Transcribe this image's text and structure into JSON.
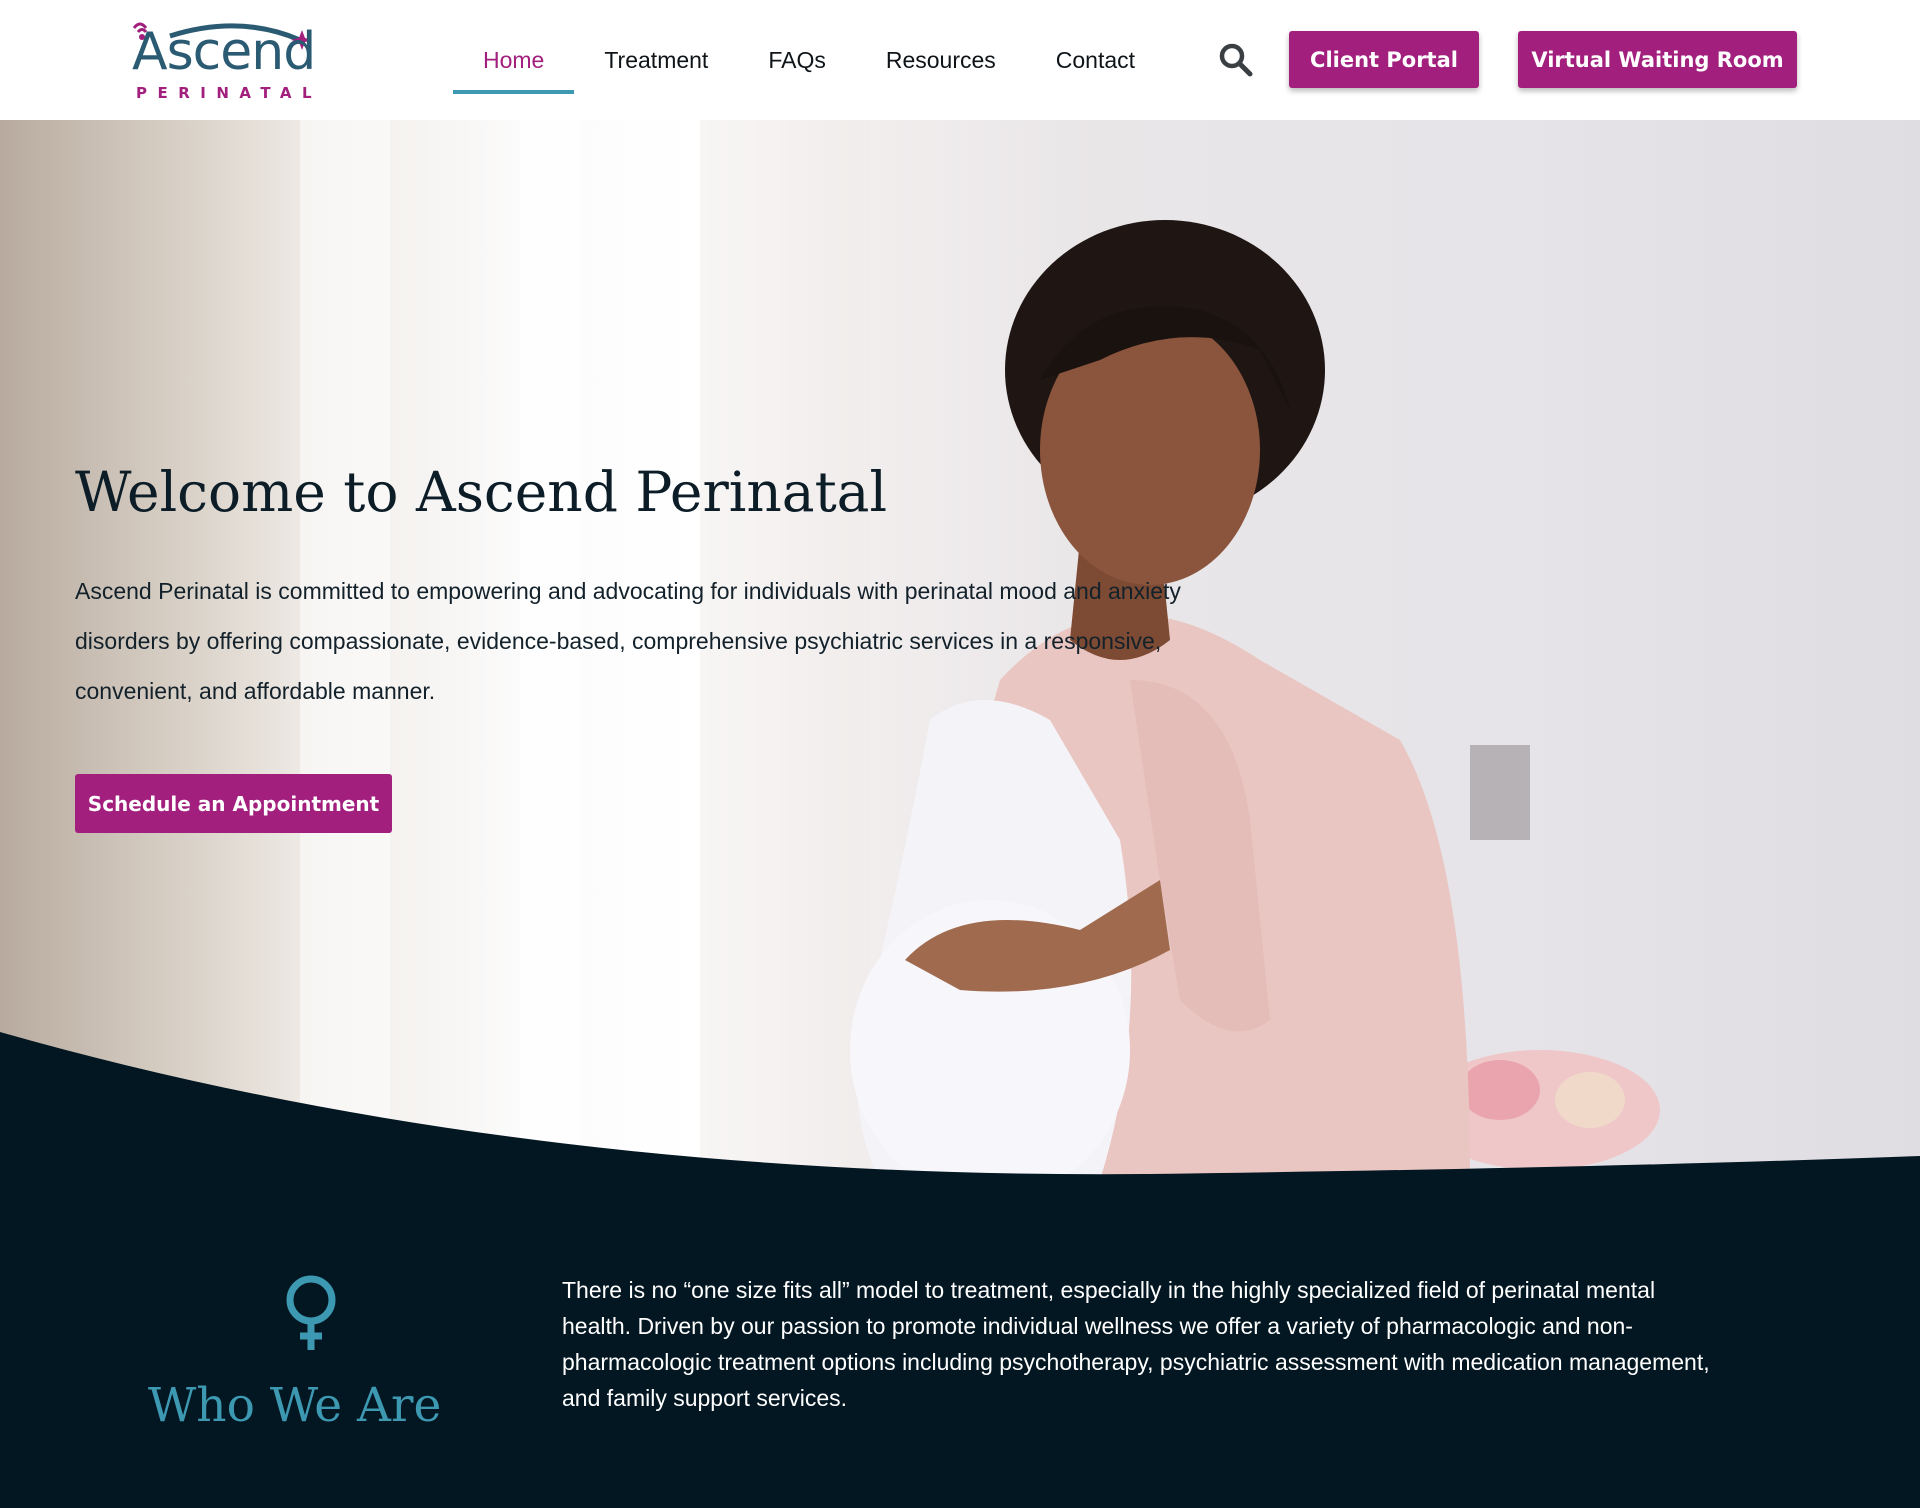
{
  "brand": {
    "name": "Ascend",
    "subname": "PERINATAL",
    "primary_color": "#a21f7d",
    "accent_color": "#3d98b2",
    "dark_color": "#031722"
  },
  "header": {
    "nav": [
      {
        "label": "Home",
        "active": true
      },
      {
        "label": "Treatment",
        "active": false
      },
      {
        "label": "FAQs",
        "active": false
      },
      {
        "label": "Resources",
        "active": false
      },
      {
        "label": "Contact",
        "active": false
      }
    ],
    "search_icon": "search-icon",
    "client_portal_label": "Client Portal",
    "virtual_waiting_room_label": "Virtual Waiting Room"
  },
  "hero": {
    "title": "Welcome to Ascend Perinatal",
    "text": "Ascend Perinatal is committed to empowering and advocating for individuals with perinatal mood and anxiety disorders by offering compassionate, evidence-based, comprehensive psychiatric services in a responsive, convenient, and affordable manner.",
    "cta_label": "Schedule an Appointment"
  },
  "who_we_are": {
    "icon": "female-symbol-icon",
    "title": "Who We Are",
    "text": "There is no “one size fits all” model to treatment, especially in the highly specialized field of perinatal mental health. Driven by our passion to promote individual wellness we offer a variety of pharmacologic and non-pharmacologic treatment options including psychotherapy, psychiatric assessment with medication management, and family support services."
  }
}
